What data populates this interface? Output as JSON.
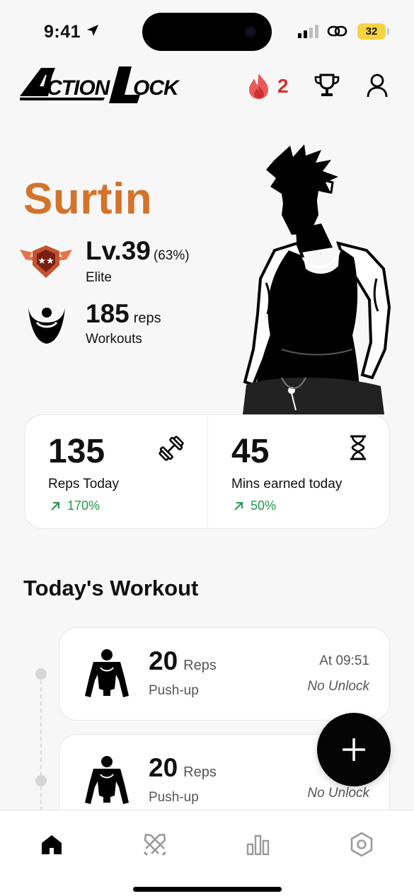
{
  "status_bar": {
    "time": "9:41",
    "battery": "32",
    "icons": [
      "location-arrow-icon",
      "signal-icon",
      "link-icon",
      "battery-icon"
    ]
  },
  "header": {
    "logo_text": "ACTIONLOCK",
    "streak_count": "2",
    "icons": [
      "flame-icon",
      "trophy-icon",
      "profile-icon"
    ]
  },
  "profile": {
    "name": "Surtin",
    "level": "Lv.39",
    "level_progress": "(63%)",
    "rank": "Elite",
    "total_reps": "185",
    "total_reps_unit": "reps",
    "total_reps_label": "Workouts"
  },
  "stats": [
    {
      "value": "135",
      "label": "Reps Today",
      "change": "170%",
      "icon": "dumbbell-icon"
    },
    {
      "value": "45",
      "label": "Mins earned today",
      "change": "50%",
      "icon": "hourglass-icon"
    }
  ],
  "section_title": "Today's Workout",
  "workouts": [
    {
      "reps": "20",
      "unit": "Reps",
      "name": "Push-up",
      "time": "At 09:51",
      "unlock": "No Unlock"
    },
    {
      "reps": "20",
      "unit": "Reps",
      "name": "Push-up",
      "time": "",
      "unlock": "No Unlock"
    }
  ],
  "tabs": [
    {
      "name": "home",
      "icon": "home-icon",
      "active": true
    },
    {
      "name": "battle",
      "icon": "crossed-swords-icon",
      "active": false
    },
    {
      "name": "stats",
      "icon": "bar-chart-icon",
      "active": false
    },
    {
      "name": "settings",
      "icon": "settings-hexagon-icon",
      "active": false
    }
  ],
  "colors": {
    "accent_orange": "#d4732a",
    "streak_red": "#d0302f",
    "positive_green": "#1e9a47",
    "background": "#f7f7f7"
  }
}
